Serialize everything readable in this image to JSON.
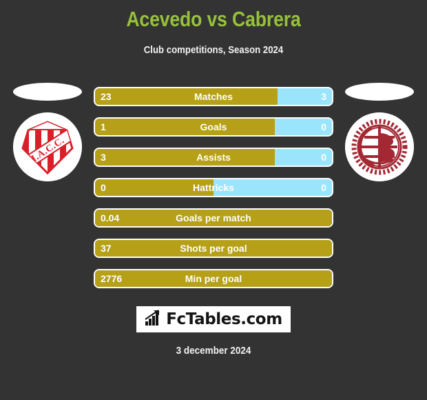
{
  "header": {
    "title": "Acevedo vs Cabrera",
    "subtitle": "Club competitions, Season 2024",
    "title_color": "#97c13c",
    "subtitle_color": "#f2f2f2"
  },
  "background_color": "#333333",
  "home": {
    "club_badge_name": "instituto-atletico-central-cordoba-badge",
    "badge_initials": "I.A.C.C.",
    "bar_color": "#b5a018"
  },
  "away": {
    "club_badge_name": "club-atletico-lanus-badge",
    "bar_color": "#9ae5fc"
  },
  "stats": [
    {
      "label": "Matches",
      "home": "23",
      "away": "3",
      "home_pct": 77,
      "dual": true
    },
    {
      "label": "Goals",
      "home": "1",
      "away": "0",
      "home_pct": 76,
      "dual": true
    },
    {
      "label": "Assists",
      "home": "3",
      "away": "0",
      "home_pct": 76,
      "dual": true
    },
    {
      "label": "Hattricks",
      "home": "0",
      "away": "0",
      "home_pct": 50,
      "dual": true
    },
    {
      "label": "Goals per match",
      "home": "0.04",
      "away": "",
      "home_pct": 100,
      "dual": false
    },
    {
      "label": "Shots per goal",
      "home": "37",
      "away": "",
      "home_pct": 100,
      "dual": false
    },
    {
      "label": "Min per goal",
      "home": "2776",
      "away": "",
      "home_pct": 100,
      "dual": false
    }
  ],
  "watermark": {
    "text": "FcTables.com",
    "icon": "bar-chart-icon",
    "background": "#ffffff",
    "text_color": "#141414"
  },
  "footer": {
    "date": "3 december 2024"
  }
}
